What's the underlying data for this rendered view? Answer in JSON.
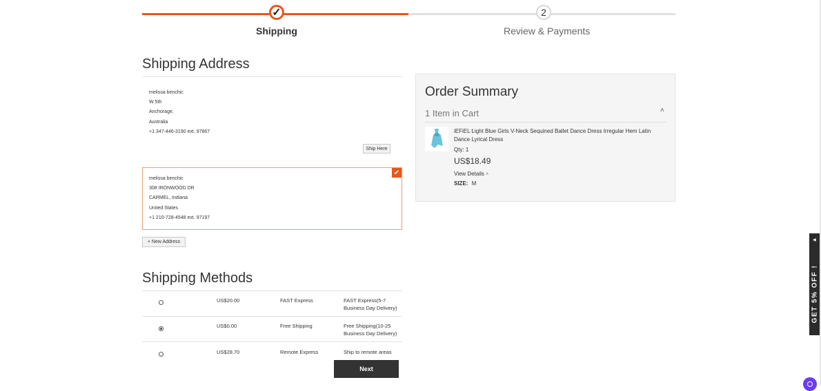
{
  "progress": {
    "steps": [
      {
        "number": "✓",
        "label": "Shipping"
      },
      {
        "number": "2",
        "label": "Review & Payments"
      }
    ]
  },
  "shipping_address": {
    "title": "Shipping Address",
    "addresses": [
      {
        "lines": [
          "melissa benchic",
          "W 5th",
          "Anchorage,",
          "Australia",
          "+1 347-446-3190 ext. 97867"
        ],
        "action": "Ship Here"
      },
      {
        "lines": [
          "melissa benchic",
          "308 IRONWOOD DR",
          "CARMEL, Indiana",
          "United States",
          "+1 210-728-4548 ext. 97197"
        ]
      }
    ],
    "new_address_label": "+ New Address"
  },
  "shipping_methods": {
    "title": "Shipping Methods",
    "rows": [
      {
        "price": "US$20.00",
        "method": "FAST Express",
        "carrier": "FAST Express(5-7 Business Day Delivery)",
        "selected": false
      },
      {
        "price": "US$0.00",
        "method": "Free Shipping",
        "carrier": "Free Shipping(10-25 Business Day Delivery)",
        "selected": true
      },
      {
        "price": "US$28.70",
        "method": "Remote Express",
        "carrier": "Ship to remote areas",
        "selected": false
      }
    ]
  },
  "next_label": "Next",
  "order_summary": {
    "title": "Order Summary",
    "items_in_cart": "1 Item in Cart",
    "item": {
      "name": "iEFiEL Light Blue Girls V-Neck Sequined Ballet Dance Dress Irregular Hem Latin Dance Lyrical Dress",
      "qty": "Qty: 1",
      "price": "US$18.49",
      "view_details": "View Details",
      "size_label": "SIZE:",
      "size_value": "M"
    }
  },
  "promo_banner": "GET 5% OFF !",
  "colors": {
    "accent": "#e8571b",
    "dark": "#333333"
  }
}
